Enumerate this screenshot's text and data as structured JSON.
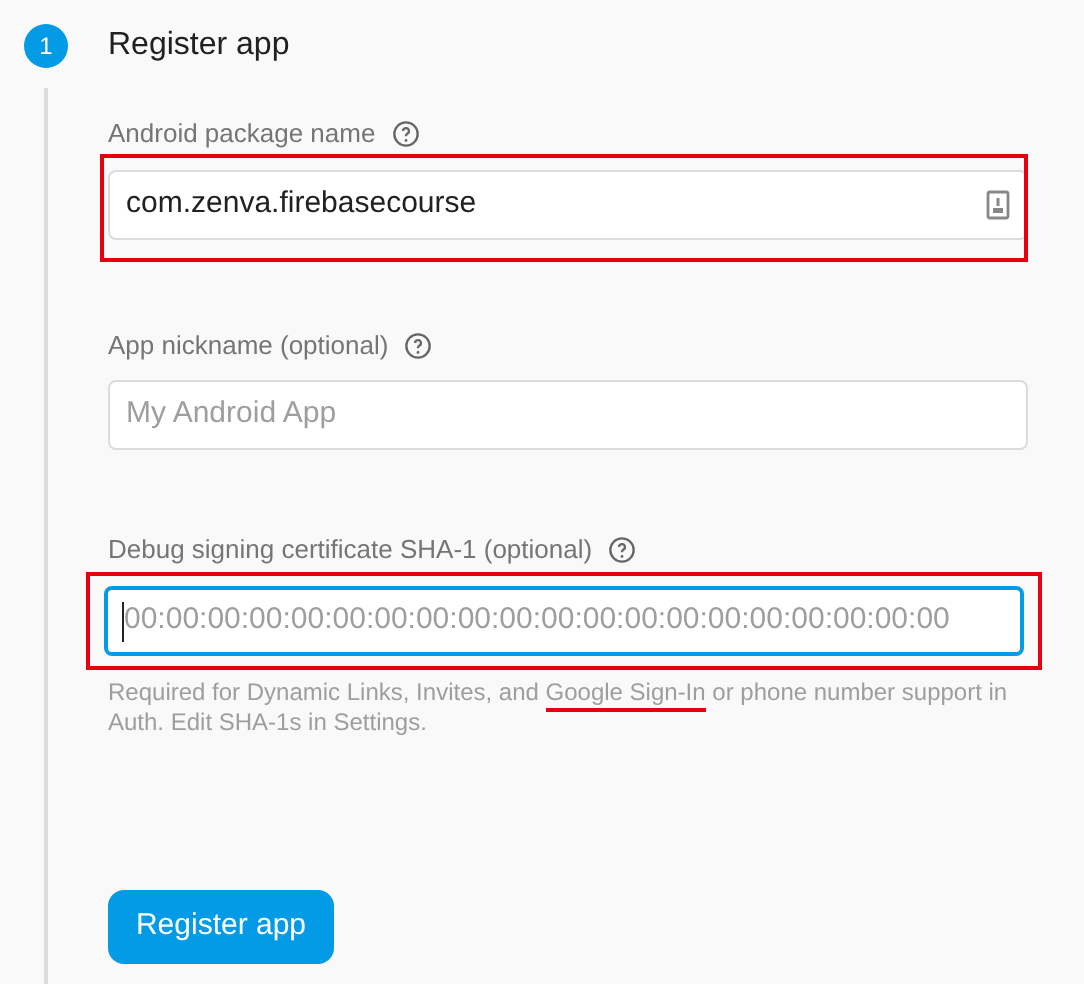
{
  "step": {
    "number": "1",
    "title": "Register app"
  },
  "fields": [
    {
      "label": "Android package name",
      "value": "com.zenva.firebasecourse",
      "icon": true,
      "focused": false,
      "highlighted": true
    },
    {
      "label": "App nickname (optional)",
      "placeholder": "My Android App",
      "icon": false,
      "focused": false,
      "highlighted": false
    },
    {
      "label": "Debug signing certificate SHA-1 (optional)",
      "placeholder": "00:00:00:00:00:00:00:00:00:00:00:00:00:00:00:00:00:00:00:00",
      "icon": false,
      "focused": true,
      "highlighted": true,
      "helper": {
        "before": "Required for Dynamic Links, Invites, and ",
        "link": "Google Sign-In",
        "link_underlined": true,
        "after": " or phone number support in Auth. Edit SHA-1s in Settings."
      }
    }
  ],
  "button": "Register app"
}
